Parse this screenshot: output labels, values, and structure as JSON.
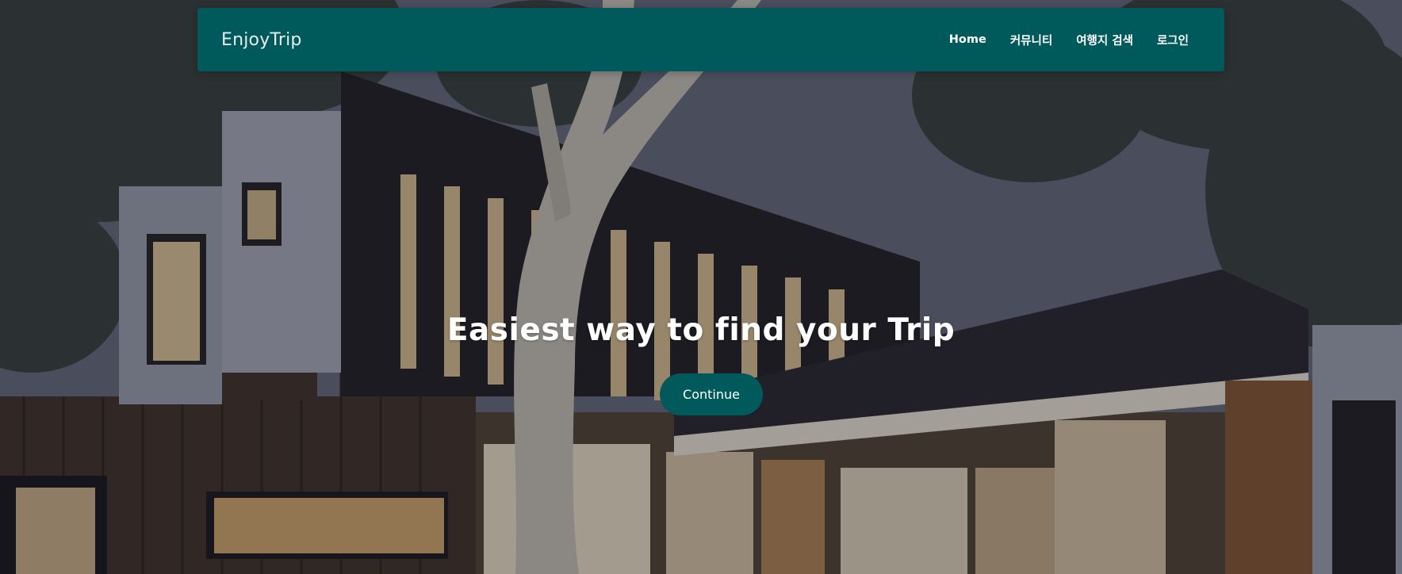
{
  "navbar": {
    "brand": "EnjoyTrip",
    "items": [
      {
        "label": "Home"
      },
      {
        "label": "커뮤니티"
      },
      {
        "label": "여행지 검색"
      },
      {
        "label": "로그인"
      }
    ]
  },
  "hero": {
    "headline": "Easiest way to find your Trip",
    "cta_label": "Continue",
    "background": "modern-house-photo"
  },
  "colors": {
    "primary": "#005a5b",
    "text_light": "#ffffff"
  }
}
